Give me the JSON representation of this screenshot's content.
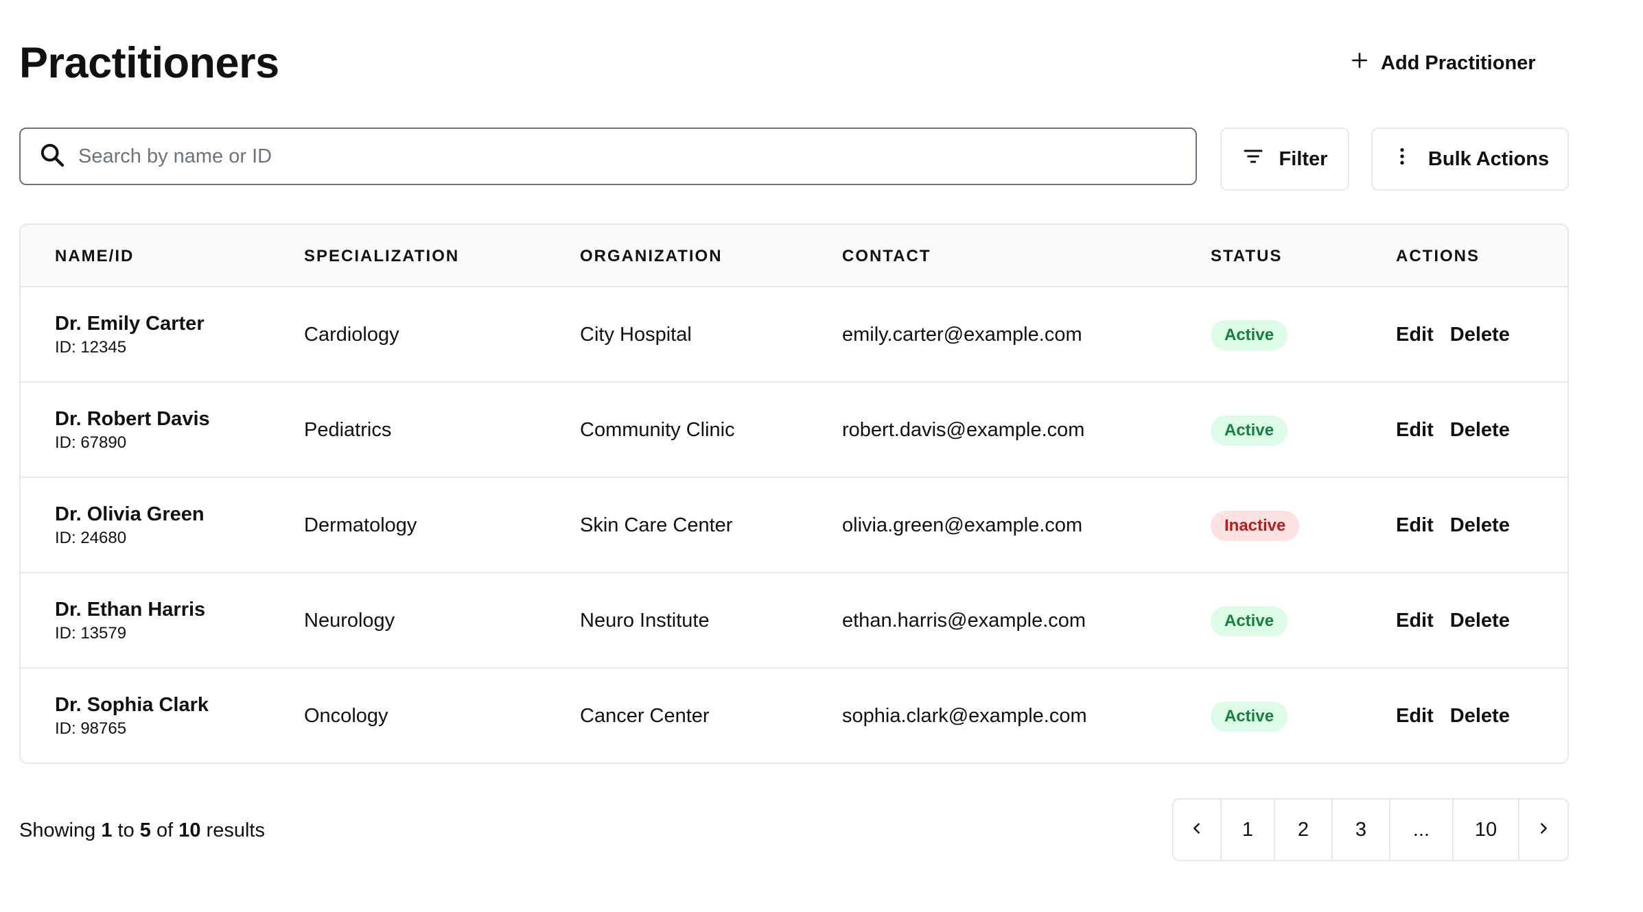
{
  "header": {
    "title": "Practitioners",
    "add_button_label": "Add Practitioner",
    "add_icon": "plus-icon"
  },
  "toolbar": {
    "search_placeholder": "Search by name or ID",
    "search_value": "",
    "search_icon": "search-icon",
    "filter_label": "Filter",
    "filter_icon": "filter-lines-icon",
    "bulk_label": "Bulk Actions",
    "bulk_icon": "vertical-dots-icon"
  },
  "table": {
    "columns": [
      "NAME/ID",
      "SPECIALIZATION",
      "ORGANIZATION",
      "CONTACT",
      "STATUS",
      "ACTIONS"
    ],
    "rows": [
      {
        "name": "Dr. Emily Carter",
        "id": "ID: 12345",
        "specialization": "Cardiology",
        "organization": "City Hospital",
        "contact": "emily.carter@example.com",
        "status": "Active",
        "edit": "Edit",
        "delete": "Delete"
      },
      {
        "name": "Dr. Robert Davis",
        "id": "ID: 67890",
        "specialization": "Pediatrics",
        "organization": "Community Clinic",
        "contact": "robert.davis@example.com",
        "status": "Active",
        "edit": "Edit",
        "delete": "Delete"
      },
      {
        "name": "Dr. Olivia Green",
        "id": "ID: 24680",
        "specialization": "Dermatology",
        "organization": "Skin Care Center",
        "contact": "olivia.green@example.com",
        "status": "Inactive",
        "edit": "Edit",
        "delete": "Delete"
      },
      {
        "name": "Dr. Ethan Harris",
        "id": "ID: 13579",
        "specialization": "Neurology",
        "organization": "Neuro Institute",
        "contact": "ethan.harris@example.com",
        "status": "Active",
        "edit": "Edit",
        "delete": "Delete"
      },
      {
        "name": "Dr. Sophia Clark",
        "id": "ID: 98765",
        "specialization": "Oncology",
        "organization": "Cancer Center",
        "contact": "sophia.clark@example.com",
        "status": "Active",
        "edit": "Edit",
        "delete": "Delete"
      }
    ]
  },
  "footer": {
    "showing_prefix": "Showing",
    "range_start": "1",
    "to_word": "to",
    "range_end": "5",
    "of_word": "of",
    "total": "10",
    "results_word": "results"
  },
  "pagination": {
    "prev_icon": "chevron-left-icon",
    "next_icon": "chevron-right-icon",
    "pages": [
      "1",
      "2",
      "3",
      "...",
      "10"
    ]
  },
  "colors": {
    "active_bg": "#dcfce7",
    "active_text": "#15803d",
    "inactive_bg": "#fee2e2",
    "inactive_text": "#b91c1c",
    "header_bg": "#f8fafc",
    "border": "#e5e7eb"
  }
}
